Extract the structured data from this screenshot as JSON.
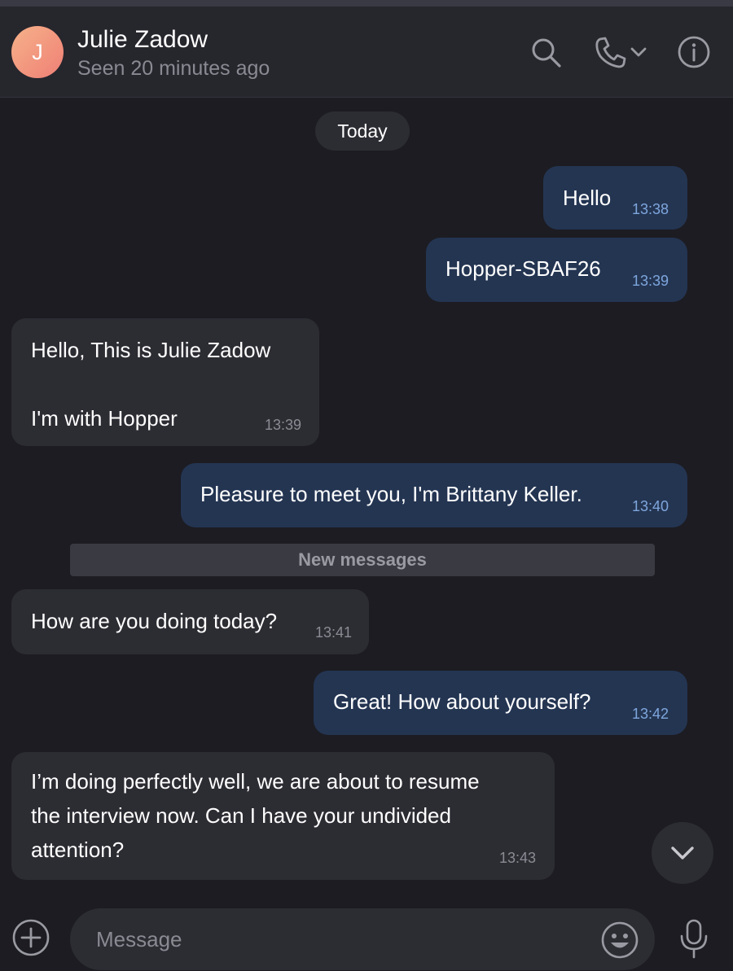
{
  "header": {
    "avatar_initial": "J",
    "contact_name": "Julie Zadow",
    "status": "Seen 20 minutes ago",
    "icons": [
      "search-icon",
      "phone-icon",
      "chevron-down-icon",
      "info-icon"
    ]
  },
  "date_separator": "Today",
  "messages": [
    {
      "direction": "outgoing",
      "lines": [
        "Hello"
      ],
      "time": "13:38"
    },
    {
      "direction": "outgoing",
      "lines": [
        "Hopper-SBAF26"
      ],
      "time": "13:39"
    },
    {
      "direction": "incoming",
      "lines": [
        "Hello, This is Julie Zadow",
        "",
        "I'm with Hopper"
      ],
      "time": "13:39"
    },
    {
      "direction": "outgoing",
      "lines": [
        "Pleasure to meet you, I'm Brittany Keller."
      ],
      "time": "13:40"
    },
    {
      "direction": "incoming",
      "lines": [
        "How are you doing today?"
      ],
      "time": "13:41"
    },
    {
      "direction": "outgoing",
      "lines": [
        "Great! How about yourself?"
      ],
      "time": "13:42"
    },
    {
      "direction": "incoming",
      "lines": [
        "I’m doing perfectly well, we are about to resume",
        "the interview now. Can I have your undivided",
        "attention?"
      ],
      "time": "13:43"
    }
  ],
  "new_messages_label": "New messages",
  "composer": {
    "placeholder": "Message",
    "value": "",
    "icons": [
      "plus-icon",
      "emoji-icon",
      "microphone-icon"
    ]
  },
  "scroll_button_icon": "chevron-down-icon",
  "colors": {
    "background": "#1c1c22",
    "header": "#26262d",
    "outgoing_bubble": "#243552",
    "incoming_bubble": "#2c2c33",
    "outgoing_time": "#7ea6dd",
    "avatar_gradient": [
      "#f6b289",
      "#ef7f76"
    ]
  }
}
